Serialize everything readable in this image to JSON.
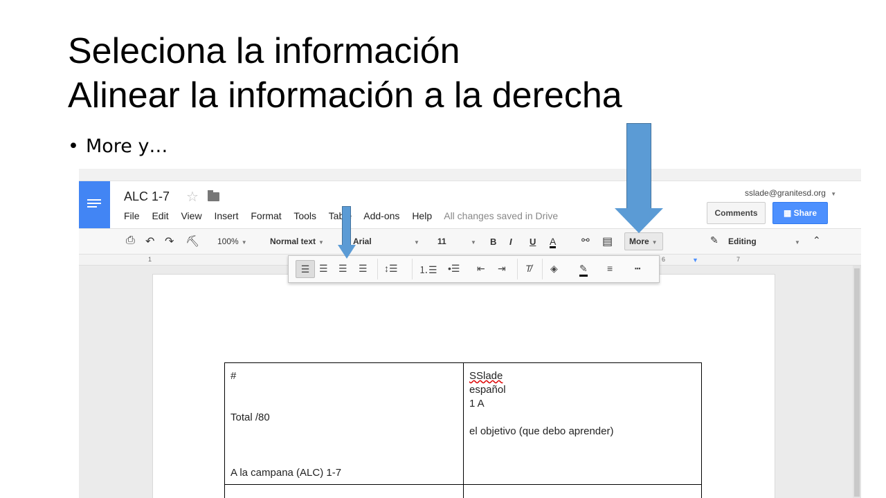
{
  "slide": {
    "title_line1": "Seleciona la información",
    "title_line2": "Alinear la información a la derecha",
    "bullet": "More y…"
  },
  "doc": {
    "title": "ALC 1-7",
    "menu": [
      "File",
      "Edit",
      "View",
      "Insert",
      "Format",
      "Tools",
      "Table",
      "Add-ons",
      "Help"
    ],
    "save_status": "All changes saved in Drive",
    "account": "sslade@granitesd.org",
    "comments_label": "Comments",
    "share_label": "Share"
  },
  "toolbar": {
    "zoom": "100%",
    "style": "Normal text",
    "font": "Arial",
    "size": "11",
    "bold": "B",
    "italic": "I",
    "underline": "U",
    "text_color": "A",
    "more_label": "More",
    "mode": "Editing"
  },
  "ruler": {
    "n1": "1",
    "n6": "6",
    "n7": "7"
  },
  "table": {
    "cell1": "#",
    "cell2": "Total    /80",
    "cell3": "A la campana (ALC) 1-7",
    "cell4": "SSlade",
    "cell5": "español",
    "cell6": "1 A",
    "cell7": "el objetivo (que debo aprender)"
  },
  "colors": {
    "accent": "#4285f4",
    "share": "#4d90fe",
    "arrow": "#5b9bd5"
  }
}
